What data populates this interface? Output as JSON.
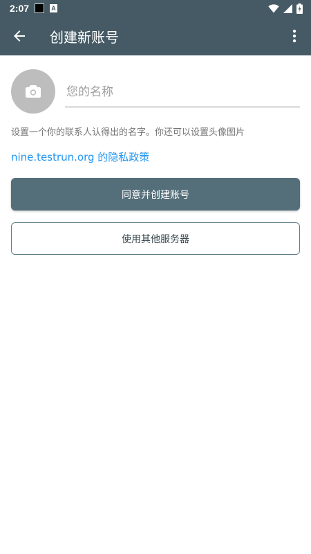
{
  "status_bar": {
    "time": "2:07",
    "notification_icons": [
      "black-square-icon",
      "a-letter-icon"
    ],
    "indicators": [
      "wifi-icon",
      "cellular-signal-icon",
      "battery-charging-icon"
    ]
  },
  "app_bar": {
    "title": "创建新账号",
    "back_icon": "arrow-back-icon",
    "overflow_icon": "more-vert-icon"
  },
  "profile": {
    "avatar_icon": "camera-icon",
    "name_value": "",
    "name_placeholder": "您的名称"
  },
  "hint_text": "设置一个你的联系人认得出的名字。你还可以设置头像图片",
  "privacy_link": "nine.testrun.org 的隐私政策",
  "buttons": {
    "agree_create": "同意并创建账号",
    "use_other_server": "使用其他服务器"
  },
  "colors": {
    "toolbar": "#455a64",
    "primary_button": "#546e7a",
    "link": "#2196f3",
    "avatar_bg": "#bdbdbd"
  }
}
